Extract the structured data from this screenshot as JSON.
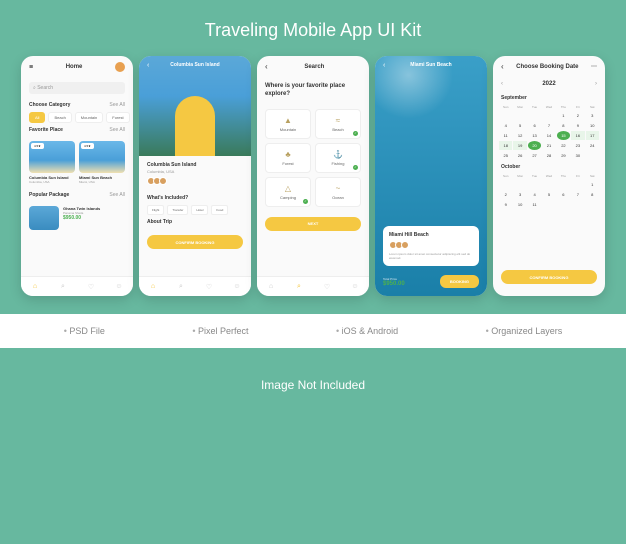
{
  "title": "Traveling Mobile App UI Kit",
  "features": [
    "PSD File",
    "Pixel Perfect",
    "iOS & Android",
    "Organized Layers"
  ],
  "footer": "Image Not Included",
  "screen1": {
    "header": "Home",
    "search_placeholder": "Search",
    "category_label": "Choose Category",
    "see_all": "See All",
    "chips": [
      "All",
      "Beach",
      "Mountain",
      "Forest"
    ],
    "favorite_label": "Favorite Place",
    "cards": [
      {
        "title": "Columbia Sun Island",
        "sub": "Columbia, USA"
      },
      {
        "title": "Miami Sun Beach",
        "sub": "Miami, USA"
      }
    ],
    "popular_label": "Popular Package",
    "pkg": {
      "title": "Ghana Twin Islands",
      "sub": "Panama Sheila",
      "price": "$950.00"
    }
  },
  "screen2": {
    "header": "Columbia Sun Island",
    "title": "Columbia Sun Island",
    "sub": "Columbia, USA",
    "included_label": "What's Included?",
    "chips": [
      "Flight",
      "Transfer",
      "Hotel",
      "Food"
    ],
    "about_label": "About Trip",
    "button": "Confirm Booking"
  },
  "screen3": {
    "header": "Search",
    "question": "Where is your favorite place explore?",
    "cats": [
      {
        "label": "Mountain",
        "icon": "▲"
      },
      {
        "label": "Beach",
        "icon": "≈",
        "checked": true
      },
      {
        "label": "Forest",
        "icon": "♣"
      },
      {
        "label": "Fishing",
        "icon": "⚓",
        "checked": true
      },
      {
        "label": "Camping",
        "icon": "△",
        "checked": true
      },
      {
        "label": "Ocean",
        "icon": "~"
      }
    ],
    "button": "Next"
  },
  "screen4": {
    "header": "Miami Sun Beach",
    "card_title": "Miami Hill Beach",
    "card_desc": "Lorem ipsum dolor sit amet consectetur adipiscing elit sed do eiusmod.",
    "price_label": "Total Price",
    "price": "$950.00",
    "button": "Booking"
  },
  "screen5": {
    "header": "Choose Booking Date",
    "year": "2022",
    "month1": "September",
    "month2": "October",
    "day_headers": [
      "Sun",
      "Mon",
      "Tue",
      "Wed",
      "Thu",
      "Fri",
      "Sat"
    ],
    "sept": [
      "",
      "",
      "",
      "",
      "1",
      "2",
      "3",
      "4",
      "5",
      "6",
      "7",
      "8",
      "9",
      "10",
      "11",
      "12",
      "13",
      "14",
      "15",
      "16",
      "17",
      "18",
      "19",
      "20",
      "21",
      "22",
      "23",
      "24",
      "25",
      "26",
      "27",
      "28",
      "29",
      "30",
      ""
    ],
    "sel_start": "15",
    "sel_end": "20",
    "oct": [
      "",
      "",
      "",
      "",
      "",
      "",
      "1",
      "2",
      "3",
      "4",
      "5",
      "6",
      "7",
      "8",
      "9",
      "10",
      "11",
      ""
    ],
    "button": "Confirm Booking"
  }
}
